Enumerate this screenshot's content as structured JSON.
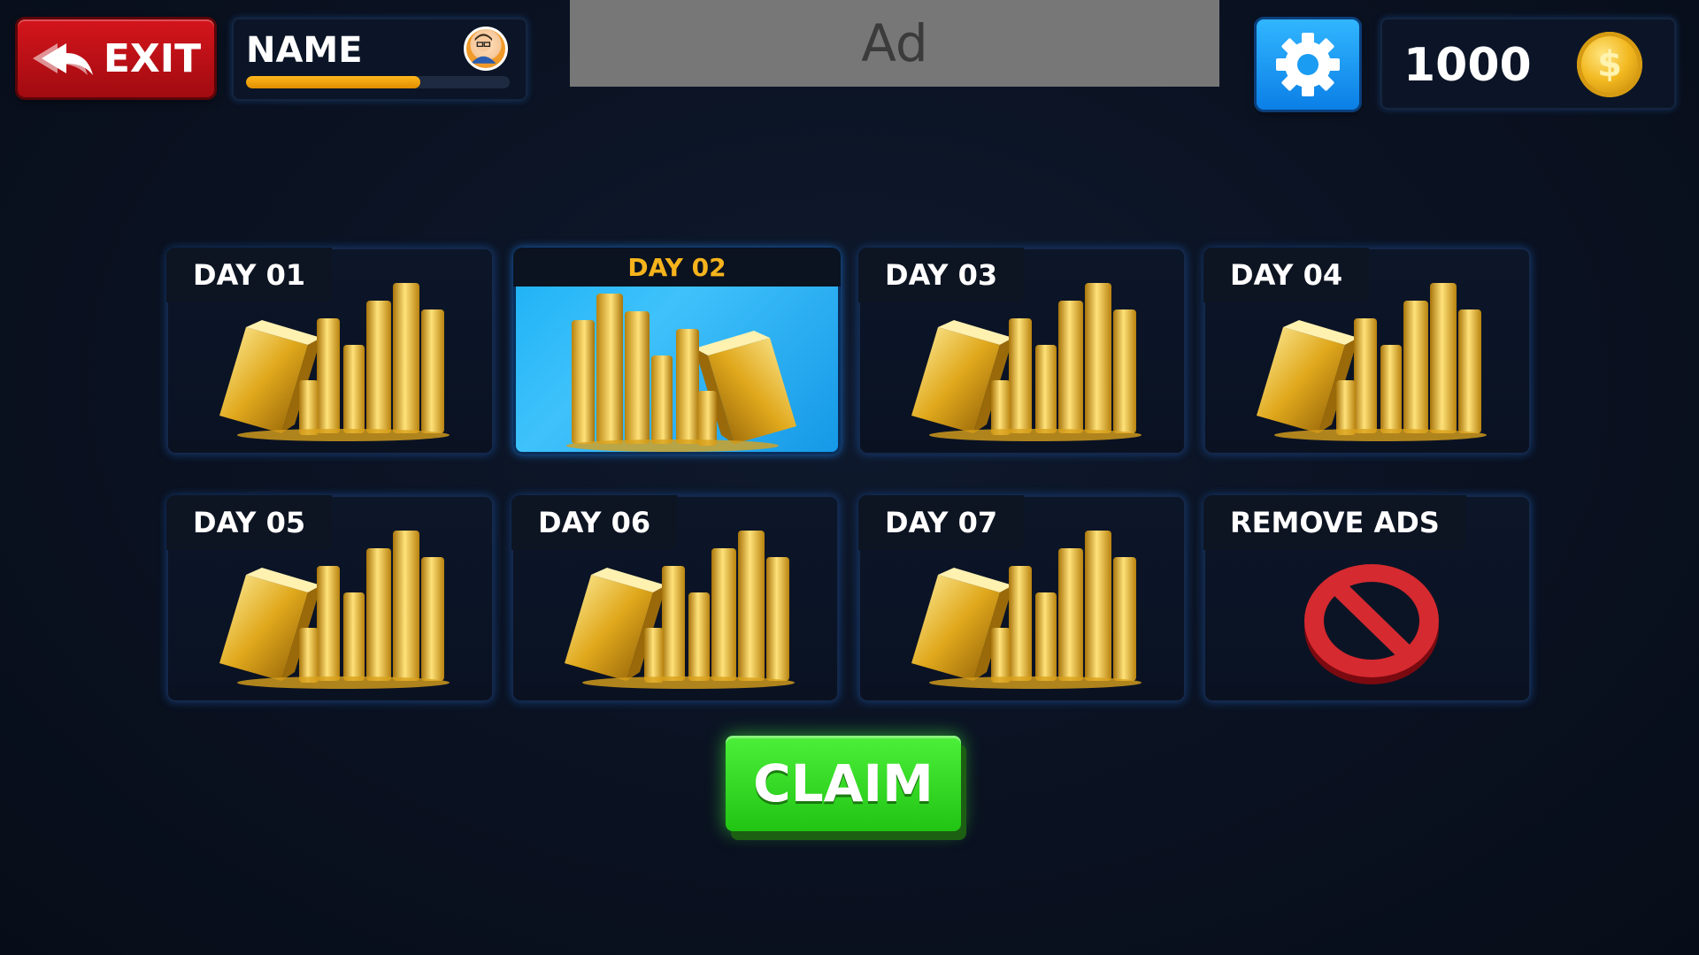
{
  "header": {
    "exit_label": "EXIT",
    "player_name": "NAME",
    "xp_fraction": 0.66,
    "ad_label": "Ad",
    "coins": "1000",
    "coin_symbol": "$"
  },
  "rewards": [
    {
      "label": "DAY 01"
    },
    {
      "label": "DAY 02",
      "active": true
    },
    {
      "label": "DAY 03"
    },
    {
      "label": "DAY 04"
    },
    {
      "label": "DAY 05"
    },
    {
      "label": "DAY 06"
    },
    {
      "label": "DAY 07"
    },
    {
      "label": "REMOVE ADS"
    }
  ],
  "claim_label": "CLAIM",
  "colors": {
    "exit_red": "#c8131a",
    "settings_blue": "#1a9cf2",
    "active_card": "#2bb8f8",
    "active_label": "#f6b31c",
    "claim_green": "#34d824",
    "xp_orange": "#f2a30f"
  },
  "icons": [
    "back-arrows-icon",
    "avatar-icon",
    "gear-icon",
    "coin-icon",
    "gold-stack-icon",
    "no-sign-icon"
  ]
}
